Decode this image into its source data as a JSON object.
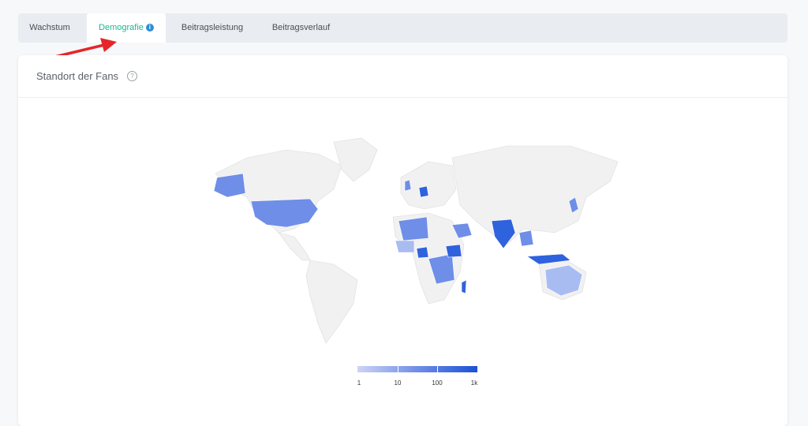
{
  "tabs": [
    {
      "label": "Wachstum"
    },
    {
      "label": "Demografie",
      "active": true,
      "info_icon": "info-icon"
    },
    {
      "label": "Beitragsleistung"
    },
    {
      "label": "Beitragsverlauf"
    }
  ],
  "card": {
    "title": "Standort der Fans",
    "help_icon": "question-mark-icon",
    "help_glyph": "?"
  },
  "info_glyph": "i",
  "legend": {
    "labels": [
      "1",
      "10",
      "100",
      "1k"
    ],
    "color_low": "#ccd4f7",
    "color_high": "#1a52d6"
  },
  "colors": {
    "accent": "#19b98e",
    "arrow": "#e4262b",
    "map_base": "#f1f1f1",
    "shade_light": "#a9bcf2",
    "shade_mid": "#6f8ee8",
    "shade_dark": "#2f62dd"
  }
}
